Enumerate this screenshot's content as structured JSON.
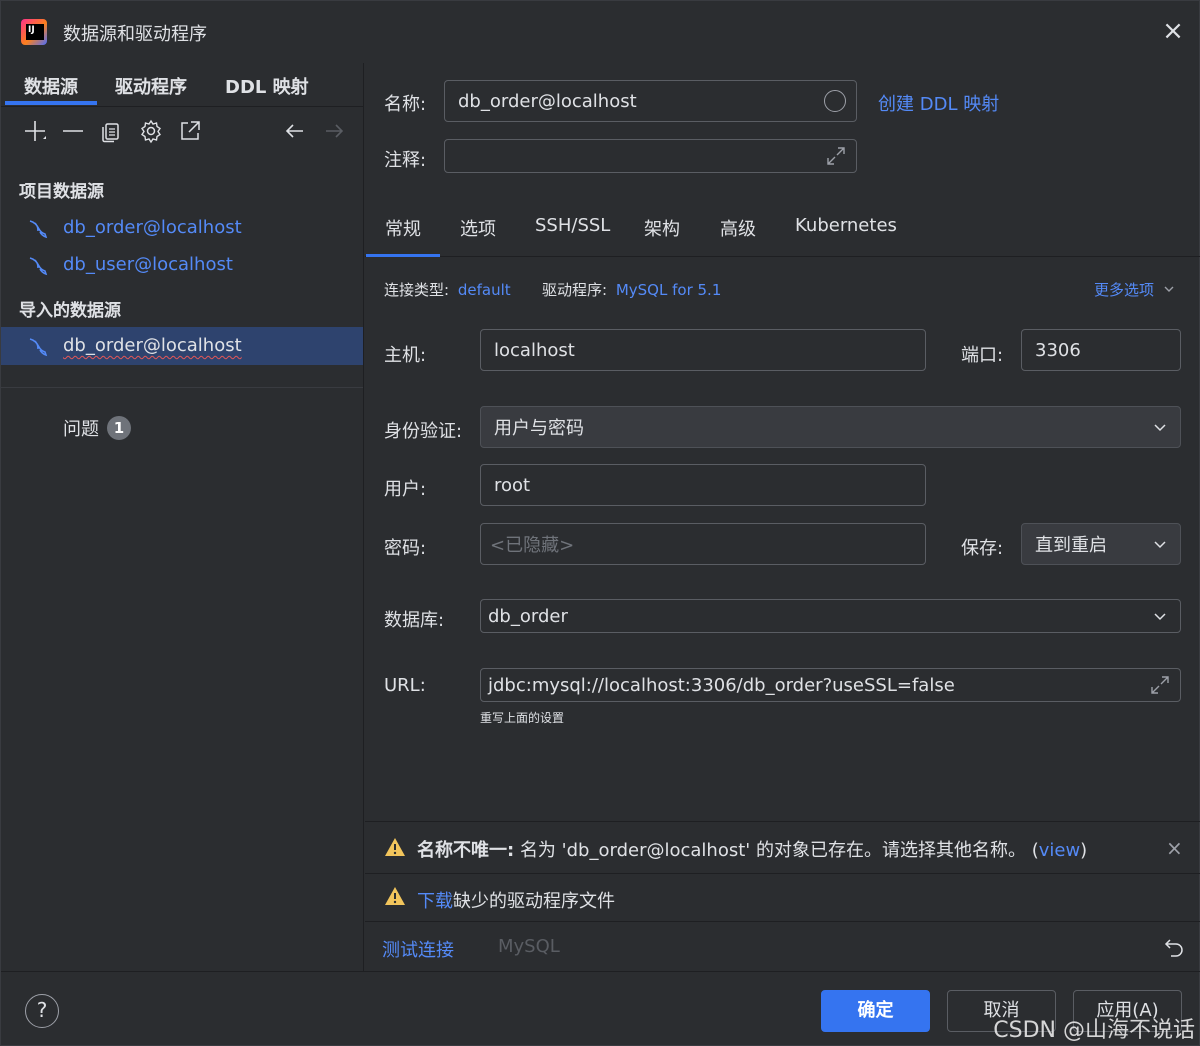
{
  "window": {
    "title": "数据源和驱动程序",
    "close": "×"
  },
  "left": {
    "tabs": [
      "数据源",
      "驱动程序",
      "DDL 映射"
    ],
    "project_section": "项目数据源",
    "project_items": [
      "db_order@localhost",
      "db_user@localhost"
    ],
    "imported_section": "导入的数据源",
    "imported_items": [
      "db_order@localhost"
    ],
    "problems_label": "问题",
    "problems_count": "1"
  },
  "form": {
    "name_label": "名称:",
    "name_value": "db_order@localhost",
    "create_ddl_link": "创建 DDL 映射",
    "comment_label": "注释:",
    "comment_value": ""
  },
  "tabs": [
    "常规",
    "选项",
    "SSH/SSL",
    "架构",
    "高级",
    "Kubernetes"
  ],
  "general": {
    "conn_type_label": "连接类型:",
    "conn_type_value": "default",
    "driver_label": "驱动程序:",
    "driver_value": "MySQL for 5.1",
    "more_options": "更多选项",
    "host_label": "主机:",
    "host_value": "localhost",
    "port_label": "端口:",
    "port_value": "3306",
    "auth_label": "身份验证:",
    "auth_value": "用户与密码",
    "user_label": "用户:",
    "user_value": "root",
    "password_label": "密码:",
    "password_placeholder": "<已隐藏>",
    "save_label": "保存:",
    "save_value": "直到重启",
    "database_label": "数据库:",
    "database_value": "db_order",
    "url_label": "URL:",
    "url_value": "jdbc:mysql://localhost:3306/db_order?useSSL=false",
    "url_hint": "重写上面的设置"
  },
  "warnings": {
    "name_title": "名称不唯一:",
    "name_text_pre": "名为",
    "name_quoted": "'db_order@localhost'",
    "name_text_post": "的对象已存在。请选择其他名称。",
    "view_open": "(",
    "view_link": "view",
    "view_close": ")",
    "download_link": "下载",
    "download_text": "缺少的驱动程序文件"
  },
  "bottom": {
    "test_link": "测试连接",
    "db_kind": "MySQL"
  },
  "footer": {
    "help": "?",
    "ok": "确定",
    "cancel": "取消",
    "apply": "应用(A)",
    "watermark": "CSDN @山海不说话"
  }
}
